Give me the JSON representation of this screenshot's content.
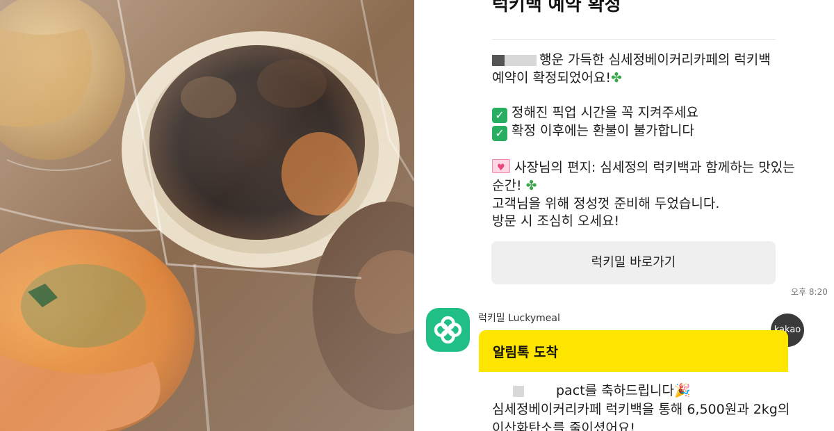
{
  "photo": {
    "description_icon": "pastry-photo"
  },
  "chat": {
    "partial_title": "럭키백 예약 확정",
    "message1": {
      "line1_suffix": "행운 가득한 심세정베이커리카페의 럭키백",
      "line2": "예약이 확정되었어요!",
      "check1": "정해진 픽업 시간을 꼭 지켜주세요",
      "check2": "확정 이후에는 환불이 불가합니다",
      "letter_line1": "사장님의 편지: 심세정의 럭키백과 함께하는 맛있는",
      "letter_line2": "순간!",
      "letter_line3": "고객님을 위해 정성껏 준비해 두었습니다.",
      "letter_line4": "방문 시 조심히 오세요!",
      "button_label": "럭키밀 바로가기",
      "time": "오후 8:20"
    },
    "message2": {
      "sender": "럭키밀 Luckymeal",
      "badge": "kakao",
      "header": "알림톡 도착",
      "line1_suffix": "pact를 축하드립니다",
      "line2": "심세정베이커리카페 럭키백을 통해 6,500원과 2kg의",
      "line3": "이산화탄소를 줄이셨어요!"
    },
    "colors": {
      "kakao_yellow": "#fee500",
      "luckymeal_green": "#1fbf86",
      "check_green": "#27ae60"
    }
  }
}
